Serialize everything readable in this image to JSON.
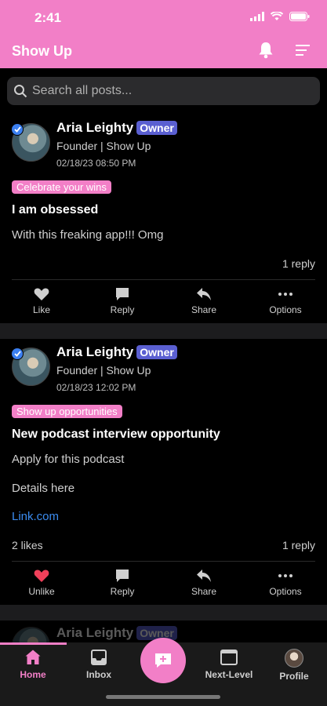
{
  "status_bar": {
    "time": "2:41"
  },
  "header": {
    "title": "Show Up"
  },
  "search": {
    "placeholder": "Search all posts..."
  },
  "posts": [
    {
      "author": "Aria Leighty",
      "badge": "Owner",
      "role": "Founder | Show Up",
      "date": "02/18/23 08:50 PM",
      "tag": "Celebrate your wins",
      "title": "I am obsessed",
      "body": "With this freaking app!!! Omg",
      "likes": "",
      "replies": "1 reply",
      "actions": {
        "like": "Like",
        "reply": "Reply",
        "share": "Share",
        "options": "Options"
      }
    },
    {
      "author": "Aria Leighty",
      "badge": "Owner",
      "role": "Founder | Show Up",
      "date": "02/18/23 12:02 PM",
      "tag": "Show up opportunities",
      "title": "New podcast interview opportunity",
      "body_lines": [
        "Apply for this podcast",
        "Details here"
      ],
      "link": "Link.com",
      "likes": "2 likes",
      "replies": "1 reply",
      "actions": {
        "like": "Unlike",
        "reply": "Reply",
        "share": "Share",
        "options": "Options"
      }
    },
    {
      "author": "Aria Leighty",
      "badge": "Owner"
    }
  ],
  "tabbar": {
    "items": [
      {
        "label": "Home",
        "icon": "home-icon",
        "active": true
      },
      {
        "label": "Inbox",
        "icon": "inbox-icon"
      },
      {
        "label": "Next-Level",
        "icon": "window-icon"
      },
      {
        "label": "Profile",
        "icon": "profile-avatar"
      }
    ]
  },
  "colors": {
    "accent": "#f27fc7",
    "owner_badge": "#5a5fd1",
    "link": "#3b8cf0",
    "liked_heart": "#f0405a"
  }
}
